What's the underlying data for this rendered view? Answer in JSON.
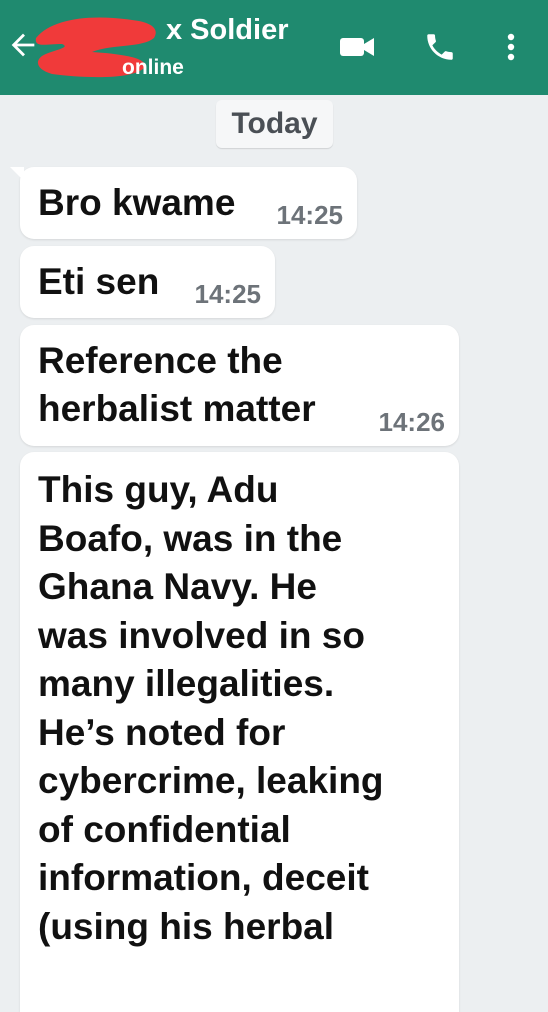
{
  "header": {
    "contact_name_visible": "x Soldier",
    "status": "online",
    "icons": {
      "back": "arrow-back-icon",
      "video": "video-camera-icon",
      "call": "phone-icon",
      "menu": "more-vertical-icon"
    },
    "background_color": "#1f8a6f"
  },
  "date_separator": "Today",
  "messages": [
    {
      "text": "Bro kwame",
      "time": "14:25"
    },
    {
      "text": "Eti sen",
      "time": "14:25"
    },
    {
      "text": "Reference the\nherbalist matter",
      "time": "14:26"
    },
    {
      "text": "This guy, Adu\nBoafo, was in the\nGhana Navy. He\nwas involved in so\nmany illegalities.\nHe’s noted for\ncybercrime, leaking\nof confidential\ninformation, deceit\n(using his herbal",
      "time": ""
    }
  ],
  "colors": {
    "chat_background": "#eceff1",
    "bubble": "#ffffff",
    "redaction": "#f03a3a"
  }
}
